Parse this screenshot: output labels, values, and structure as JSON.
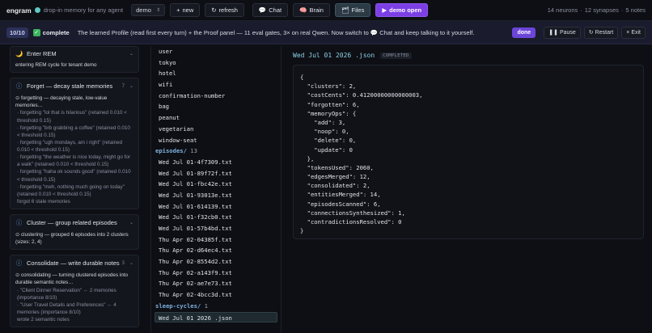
{
  "topbar": {
    "brand": "engram",
    "tagline": "drop-in memory for any agent",
    "tenant_select": "demo",
    "new_label": "new",
    "refresh_label": "refresh",
    "tabs": [
      {
        "label": "Chat",
        "icon": "chat-bubble-icon",
        "active": false
      },
      {
        "label": "Brain",
        "icon": "brain-icon",
        "active": false
      },
      {
        "label": "Files",
        "icon": "folder-icon",
        "active": true
      }
    ],
    "demo_label": "demo open",
    "stats": {
      "neurons": "14 neurons",
      "synapses": "12 synapses",
      "notes": "5 notes"
    }
  },
  "notice": {
    "counter": "10/10",
    "status": "complete",
    "text": "The learned Profile (read first every turn) + the Proof panel — 11 eval gates, 3× on real Qwen. Now switch to 💬 Chat and keep talking to it yourself.",
    "done_label": "done",
    "pause_label": "Pause",
    "restart_label": "Restart",
    "exit_label": "Exit"
  },
  "steps": [
    {
      "icon": "moon-icon",
      "title": "Enter REM",
      "count": "",
      "body": [
        {
          "text": "entering REM cycle for tenant demo",
          "kind": "main"
        }
      ]
    },
    {
      "icon": "info-circle-icon",
      "title": "Forget — decay stale memories",
      "count": "7",
      "body": [
        {
          "text": "⊙ forgetting — decaying stale, low-value memories…",
          "kind": "main"
        },
        {
          "text": "· forgetting \"lol that is hilarious\" (retained 0.010 < threshold 0.15)",
          "kind": "item"
        },
        {
          "text": "· forgetting \"brb grabbing a coffee\" (retained 0.010 < threshold 0.15)",
          "kind": "item"
        },
        {
          "text": "· forgetting \"ugh mondays, am i right\" (retained 0.010 < threshold 0.15)",
          "kind": "item"
        },
        {
          "text": "· forgetting \"the weather is nice today, might go for a walk\" (retained 0.010 < threshold 0.15)",
          "kind": "item"
        },
        {
          "text": "· forgetting \"haha ok sounds good\" (retained 0.010 < threshold 0.15)",
          "kind": "item"
        },
        {
          "text": "· forgetting \"meh, nothing much going on today\" (retained 0.010 < threshold 0.15)",
          "kind": "item"
        },
        {
          "text": "forgot 6 stale memories",
          "kind": "item"
        }
      ]
    },
    {
      "icon": "info-circle-icon",
      "title": "Cluster — group related episodes",
      "count": "",
      "body": [
        {
          "text": "⊙ clustering — grouped 6 episodes into 2 clusters (sizes: 2, 4)",
          "kind": "main"
        }
      ]
    },
    {
      "icon": "info-circle-icon",
      "title": "Consolidate — write durable notes",
      "count": "3",
      "body": [
        {
          "text": "⊙ consolidating — turning clustered episodes into durable semantic notes…",
          "kind": "main"
        },
        {
          "text": "· \"Client Dinner Reservation\" ← 2 memories (importance 8/10)",
          "kind": "item"
        },
        {
          "text": "· \"User Travel Details and Preferences\" ← 4 memories (importance 8/10)",
          "kind": "item"
        },
        {
          "text": "wrote 2 semantic notes",
          "kind": "item"
        }
      ]
    }
  ],
  "files": {
    "profile_items": [
      "user",
      "tokyo",
      "hotel",
      "wifi",
      "confirmation-number",
      "bag",
      "peanut",
      "vegetarian",
      "window-seat"
    ],
    "episodes_dir": "episodes/",
    "episodes_count": "13",
    "episodes": [
      "Wed Jul 01-4f7309.txt",
      "Wed Jul 01-89f72f.txt",
      "Wed Jul 01-fbc42e.txt",
      "Wed Jul 01-93013e.txt",
      "Wed Jul 01-614139.txt",
      "Wed Jul 01-f32cb0.txt",
      "Wed Jul 01-57b4bd.txt",
      "Thu Apr 02-04385f.txt",
      "Thu Apr 02-d64ec4.txt",
      "Thu Apr 02-8554d2.txt",
      "Thu Apr 02-a143f9.txt",
      "Thu Apr 02-ae7e73.txt",
      "Thu Apr 02-4bcc3d.txt"
    ],
    "sleep_dir": "sleep-cycles/",
    "sleep_count": "1",
    "sleep_files": [
      "Wed Jul 01 2026 .json"
    ]
  },
  "viewer": {
    "filename": "Wed Jul 01 2026 .json",
    "status": "COMPLETED",
    "lines": [
      "{",
      "  \"clusters\": 2,",
      "  \"costCents\": 0.41200000000000003,",
      "  \"forgotten\": 6,",
      "  \"memoryOps\": {",
      "    \"add\": 3,",
      "    \"noop\": 0,",
      "    \"delete\": 0,",
      "    \"update\": 0",
      "  },",
      "  \"tokensUsed\": 2060,",
      "  \"edgesMerged\": 12,",
      "  \"consolidated\": 2,",
      "  \"entitiesMerged\": 14,",
      "  \"episodesScanned\": 6,",
      "  \"connectionsSynthesized\": 1,",
      "  \"contradictionsResolved\": 0",
      "}"
    ]
  }
}
